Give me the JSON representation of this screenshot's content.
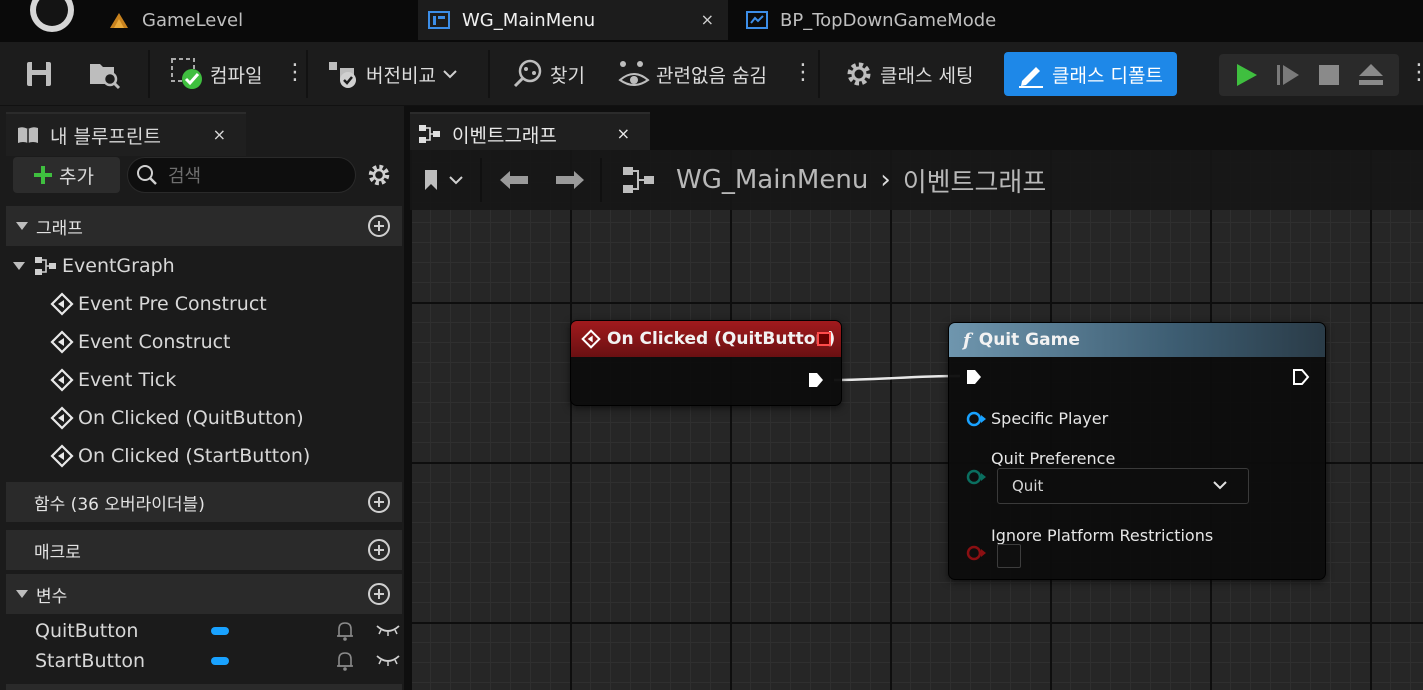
{
  "tabs": [
    {
      "label": "GameLevel",
      "icon": "level-icon",
      "active": false
    },
    {
      "label": "WG_MainMenu",
      "icon": "widget-blueprint-icon",
      "active": true
    },
    {
      "label": "BP_TopDownGameMode",
      "icon": "blueprint-icon",
      "active": false
    }
  ],
  "tab_close": "×",
  "toolbar": {
    "compile": "컴파일",
    "diff": "버전비교",
    "find": "찾기",
    "hide_unrelated": "관련없음 숨김",
    "class_settings": "클래스 세팅",
    "class_defaults": "클래스 디폴트",
    "more": "⋮"
  },
  "my_blueprint": {
    "title": "내 블루프린트",
    "close": "×",
    "add_label": "추가",
    "search_placeholder": "검색",
    "sections": {
      "graphs": "그래프",
      "functions": "함수 (36 오버라이더블)",
      "macros": "매크로",
      "variables": "변수"
    },
    "event_graph": "EventGraph",
    "events": [
      "Event Pre Construct",
      "Event Construct",
      "Event Tick",
      "On Clicked (QuitButton)",
      "On Clicked (StartButton)"
    ],
    "variables": [
      "QuitButton",
      "StartButton"
    ]
  },
  "graph": {
    "tab_label": "이벤트그래프",
    "tab_close": "×",
    "breadcrumb_root": "WG_MainMenu",
    "breadcrumb_sep": "›",
    "breadcrumb_leaf": "이벤트그래프"
  },
  "nodes": {
    "event": {
      "title": "On Clicked (QuitButton)"
    },
    "function": {
      "symbol": "f",
      "title": "Quit Game",
      "pins": {
        "specific_player": "Specific Player",
        "quit_preference": "Quit Preference",
        "quit_value": "Quit",
        "ignore_platform": "Ignore Platform Restrictions"
      }
    }
  },
  "colors": {
    "accent": "#1e88e8",
    "event_header": "#a11a1d",
    "object_pin": "#19a2ff",
    "byte_pin": "#0a6e5f",
    "bool_pin": "#8a0f12",
    "play_green": "#3fbf3f"
  }
}
